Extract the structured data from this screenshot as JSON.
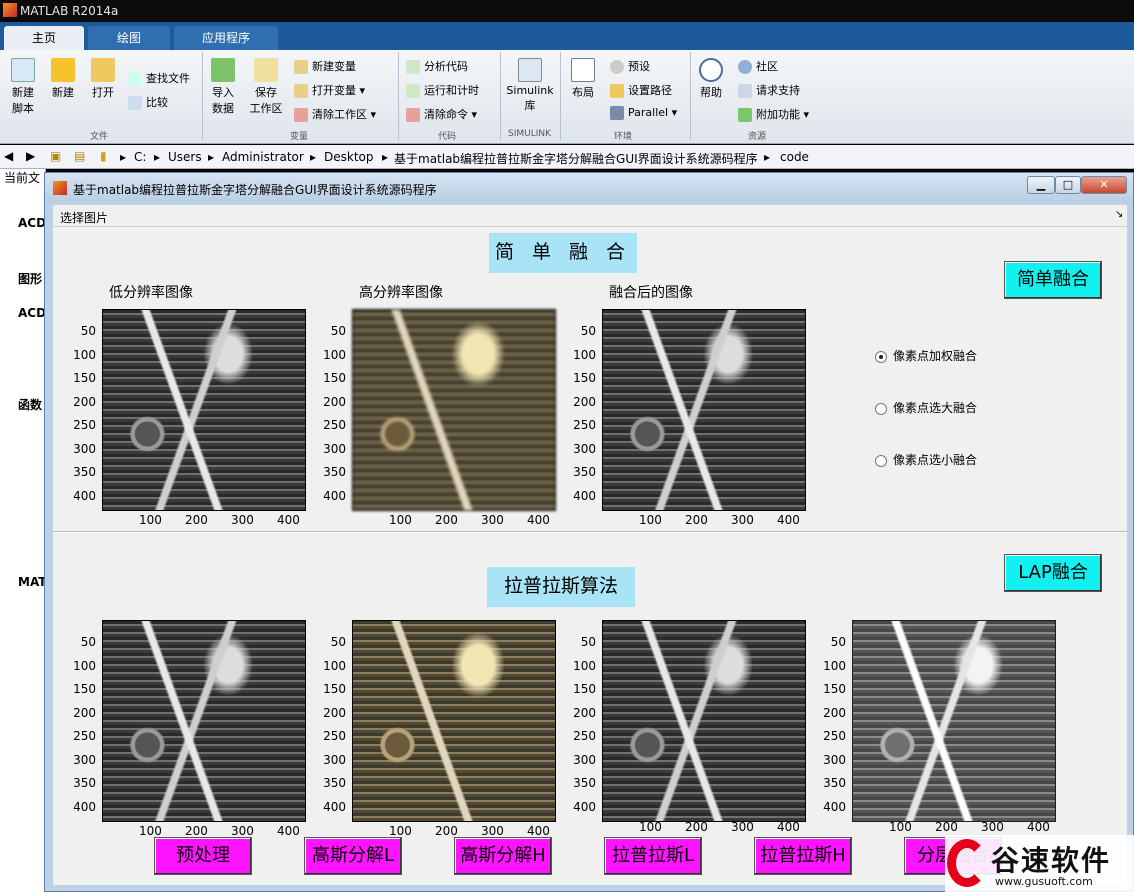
{
  "app": {
    "title": "MATLAB R2014a"
  },
  "tabs": [
    "主页",
    "绘图",
    "应用程序"
  ],
  "ribbon": {
    "file": {
      "new_script": "新建\n脚本",
      "new": "新建",
      "open": "打开",
      "find_files": "查找文件",
      "compare": "比较",
      "group": "文件"
    },
    "variable": {
      "import": "导入\n数据",
      "save_ws": "保存\n工作区",
      "new_var": "新建变量",
      "open_var": "打开变量",
      "clear_ws": "清除工作区",
      "group": "变量"
    },
    "code": {
      "analyze": "分析代码",
      "run_time": "运行和计时",
      "clear_cmd": "清除命令",
      "group": "代码"
    },
    "simulink": {
      "lib": "Simulink\n库",
      "group": "SIMULINK"
    },
    "env": {
      "layout": "布局",
      "prefs": "预设",
      "set_path": "设置路径",
      "parallel": "Parallel",
      "group": "环境"
    },
    "resources": {
      "help": "帮助",
      "community": "社区",
      "request": "请求支持",
      "addons": "附加功能",
      "group": "资源"
    }
  },
  "address": {
    "segments": [
      "C:",
      "Users",
      "Administrator",
      "Desktop",
      "基于matlab编程拉普拉斯金字塔分解融合GUI界面设计系统源码程序",
      "code"
    ]
  },
  "left_panel": {
    "header": "当前文",
    "items": [
      "ACD",
      "图形",
      "ACD",
      "函数",
      "MAT"
    ]
  },
  "figure": {
    "title": "基于matlab编程拉普拉斯金字塔分解融合GUI界面设计系统源码程序",
    "menu": "选择图片",
    "top_title": "简 单 融 合",
    "bottom_title": "拉普拉斯算法",
    "axes_titles": [
      "低分辨率图像",
      "高分辨率图像",
      "融合后的图像"
    ],
    "yticks": [
      "50",
      "100",
      "150",
      "200",
      "250",
      "300",
      "350",
      "400"
    ],
    "xticks": [
      "100",
      "200",
      "300",
      "400"
    ],
    "buttons": {
      "simple": "简单融合",
      "lap": "LAP融合"
    },
    "radios": [
      "像素点加权融合",
      "像素点选大融合",
      "像素点选小融合"
    ],
    "bottom_buttons": [
      "预处理",
      "高斯分解L",
      "高斯分解H",
      "拉普拉斯L",
      "拉普拉斯H",
      "分层融合"
    ]
  },
  "watermark": {
    "brand": "谷速软件",
    "url": "www.gusuoft.com"
  },
  "colors": {
    "cyan_button": "#12f0f0",
    "magenta_button": "#ff14ff",
    "title_bg": "#a8e4f6"
  }
}
